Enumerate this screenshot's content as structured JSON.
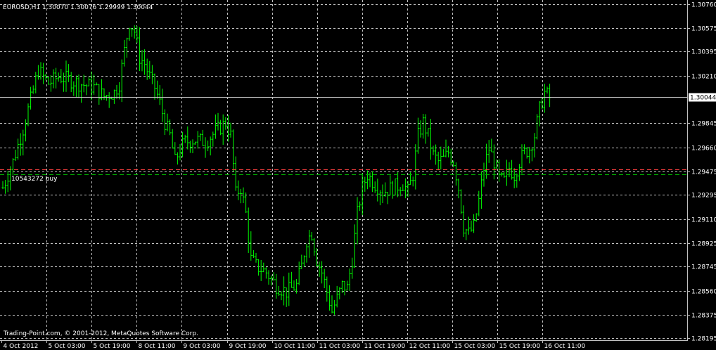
{
  "header": {
    "text": "EURUSD,H1  1.30070 1.30076 1.29999 1.30044"
  },
  "copyright": "Trading-Point.com, © 2001-2012, MetaQuotes Software Corp.",
  "order": {
    "label": "10543272 buy"
  },
  "colors": {
    "background": "#000000",
    "grid": "#c0c0c0",
    "axis_text": "#ffffff",
    "bar": "#00ff00",
    "order_open_line": "#ff4040",
    "order_sl_line": "#00b000",
    "bid_line": "#c0c0c0"
  },
  "chart_data": {
    "type": "ohlc",
    "symbol": "EURUSD",
    "timeframe": "H1",
    "last": {
      "open": 1.3007,
      "high": 1.30076,
      "low": 1.29999,
      "close": 1.30044
    },
    "price_label": "1.30044",
    "ylim": [
      1.2818,
      1.3079
    ],
    "y_ticks": [
      "1.30760",
      "1.30575",
      "1.30395",
      "1.30210",
      "1.29845",
      "1.29660",
      "1.29475",
      "1.29295",
      "1.29110",
      "1.28925",
      "1.28745",
      "1.28560",
      "1.28375",
      "1.28195"
    ],
    "x_ticks": [
      "4 Oct 2012",
      "5 Oct 03:00",
      "5 Oct 19:00",
      "8 Oct 11:00",
      "9 Oct 03:00",
      "9 Oct 19:00",
      "10 Oct 11:00",
      "11 Oct 03:00",
      "11 Oct 19:00",
      "12 Oct 11:00",
      "15 Oct 03:00",
      "15 Oct 19:00",
      "16 Oct 11:00"
    ],
    "order_open_price": 1.2949,
    "order_sl_price": 1.2945,
    "grid": true,
    "close_path": [
      [
        0,
        1.2935
      ],
      [
        4,
        1.2955
      ],
      [
        8,
        1.298
      ],
      [
        12,
        1.301
      ],
      [
        14,
        1.3025
      ],
      [
        18,
        1.3015
      ],
      [
        22,
        1.302
      ],
      [
        26,
        1.3018
      ],
      [
        30,
        1.3015
      ],
      [
        36,
        1.3012
      ],
      [
        40,
        1.3005
      ],
      [
        44,
        1.3008
      ],
      [
        46,
        1.3015
      ],
      [
        48,
        1.304
      ],
      [
        50,
        1.3062
      ],
      [
        52,
        1.3055
      ],
      [
        54,
        1.3035
      ],
      [
        56,
        1.303
      ],
      [
        58,
        1.302
      ],
      [
        60,
        1.3012
      ],
      [
        62,
        1.3
      ],
      [
        64,
        1.2985
      ],
      [
        66,
        1.2975
      ],
      [
        68,
        1.2955
      ],
      [
        70,
        1.2965
      ],
      [
        72,
        1.297
      ],
      [
        76,
        1.2972
      ],
      [
        80,
        1.297
      ],
      [
        84,
        1.2978
      ],
      [
        88,
        1.2985
      ],
      [
        90,
        1.2975
      ],
      [
        92,
        1.293
      ],
      [
        94,
        1.2935
      ],
      [
        96,
        1.2915
      ],
      [
        98,
        1.288
      ],
      [
        100,
        1.2875
      ],
      [
        104,
        1.287
      ],
      [
        108,
        1.286
      ],
      [
        112,
        1.2855
      ],
      [
        116,
        1.286
      ],
      [
        118,
        1.2875
      ],
      [
        120,
        1.2895
      ],
      [
        122,
        1.29
      ],
      [
        124,
        1.288
      ],
      [
        126,
        1.287
      ],
      [
        128,
        1.2855
      ],
      [
        130,
        1.284
      ],
      [
        132,
        1.285
      ],
      [
        134,
        1.286
      ],
      [
        136,
        1.2858
      ],
      [
        138,
        1.288
      ],
      [
        140,
        1.2915
      ],
      [
        142,
        1.2935
      ],
      [
        144,
        1.2945
      ],
      [
        146,
        1.294
      ],
      [
        150,
        1.2932
      ],
      [
        154,
        1.2935
      ],
      [
        158,
        1.2938
      ],
      [
        160,
        1.2932
      ],
      [
        162,
        1.2945
      ],
      [
        164,
        1.2975
      ],
      [
        166,
        1.2985
      ],
      [
        168,
        1.2975
      ],
      [
        170,
        1.296
      ],
      [
        172,
        1.2955
      ],
      [
        174,
        1.2957
      ],
      [
        176,
        1.2962
      ],
      [
        178,
        1.2955
      ],
      [
        180,
        1.2935
      ],
      [
        182,
        1.2905
      ],
      [
        184,
        1.29
      ],
      [
        186,
        1.2905
      ],
      [
        188,
        1.2925
      ],
      [
        190,
        1.295
      ],
      [
        192,
        1.2965
      ],
      [
        194,
        1.2955
      ],
      [
        196,
        1.2942
      ],
      [
        198,
        1.294
      ],
      [
        200,
        1.295
      ],
      [
        202,
        1.2945
      ],
      [
        204,
        1.2955
      ],
      [
        206,
        1.2962
      ],
      [
        208,
        1.2965
      ],
      [
        210,
        1.2975
      ],
      [
        212,
        1.2995
      ],
      [
        214,
        1.3008
      ],
      [
        216,
        1.3004
      ]
    ]
  }
}
